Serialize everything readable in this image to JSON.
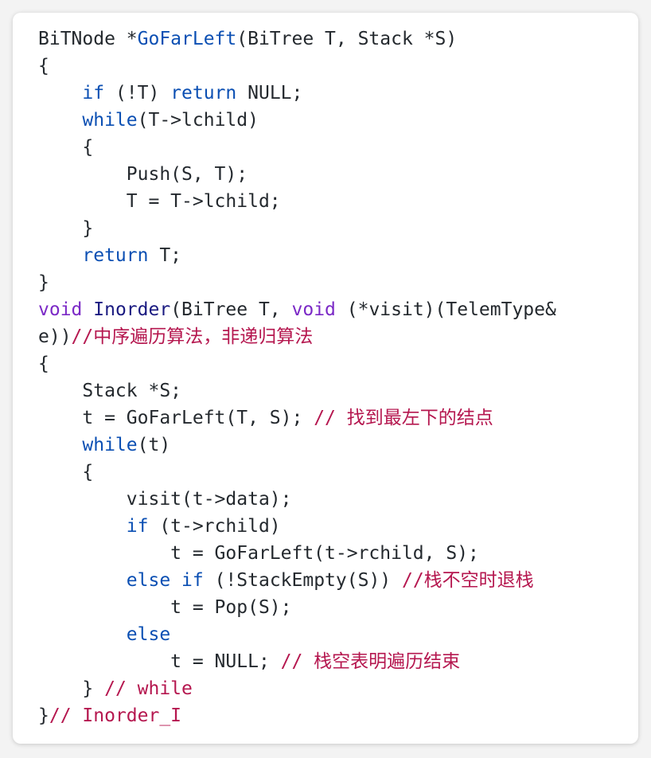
{
  "colors": {
    "background": "#f3f3f3",
    "card": "#ffffff",
    "plain": "#24292e",
    "keyword": "#0b4fb3",
    "type_keyword": "#7b29c6",
    "comment": "#b5174f"
  },
  "code": {
    "lines": [
      [
        {
          "t": "BiTNode *",
          "c": "plain"
        },
        {
          "t": "GoFarLeft",
          "c": "fn"
        },
        {
          "t": "(BiTree T, Stack *S)",
          "c": "plain"
        }
      ],
      [
        {
          "t": "{",
          "c": "plain"
        }
      ],
      [
        {
          "t": "    ",
          "c": "plain"
        },
        {
          "t": "if",
          "c": "kw"
        },
        {
          "t": " (!T) ",
          "c": "plain"
        },
        {
          "t": "return",
          "c": "kw"
        },
        {
          "t": " NULL;",
          "c": "plain"
        }
      ],
      [
        {
          "t": "    ",
          "c": "plain"
        },
        {
          "t": "while",
          "c": "kw"
        },
        {
          "t": "(T->lchild)",
          "c": "plain"
        }
      ],
      [
        {
          "t": "    {",
          "c": "plain"
        }
      ],
      [
        {
          "t": "        Push(S, T);",
          "c": "plain"
        }
      ],
      [
        {
          "t": "        T = T->lchild;",
          "c": "plain"
        }
      ],
      [
        {
          "t": "    }",
          "c": "plain"
        }
      ],
      [
        {
          "t": "    ",
          "c": "plain"
        },
        {
          "t": "return",
          "c": "kw"
        },
        {
          "t": " T;",
          "c": "plain"
        }
      ],
      [
        {
          "t": "}",
          "c": "plain"
        }
      ],
      [
        {
          "t": "void",
          "c": "type"
        },
        {
          "t": " ",
          "c": "plain"
        },
        {
          "t": "Inorder",
          "c": "fnd"
        },
        {
          "t": "(BiTree T, ",
          "c": "plain"
        },
        {
          "t": "void",
          "c": "type"
        },
        {
          "t": " (*visit)(TelemType&",
          "c": "plain"
        }
      ],
      [
        {
          "t": "e))",
          "c": "plain"
        },
        {
          "t": "//中序遍历算法，非递归算法",
          "c": "comment"
        }
      ],
      [
        {
          "t": "{",
          "c": "plain"
        }
      ],
      [
        {
          "t": "    Stack *S;",
          "c": "plain"
        }
      ],
      [
        {
          "t": "    t = GoFarLeft(T, S); ",
          "c": "plain"
        },
        {
          "t": "// 找到最左下的结点",
          "c": "comment"
        }
      ],
      [
        {
          "t": "    ",
          "c": "plain"
        },
        {
          "t": "while",
          "c": "kw"
        },
        {
          "t": "(t)",
          "c": "plain"
        }
      ],
      [
        {
          "t": "    {",
          "c": "plain"
        }
      ],
      [
        {
          "t": "        visit(t->data);",
          "c": "plain"
        }
      ],
      [
        {
          "t": "        ",
          "c": "plain"
        },
        {
          "t": "if",
          "c": "kw"
        },
        {
          "t": " (t->rchild)",
          "c": "plain"
        }
      ],
      [
        {
          "t": "            t = GoFarLeft(t->rchild, S);",
          "c": "plain"
        }
      ],
      [
        {
          "t": "        ",
          "c": "plain"
        },
        {
          "t": "else",
          "c": "kw"
        },
        {
          "t": " ",
          "c": "plain"
        },
        {
          "t": "if",
          "c": "kw"
        },
        {
          "t": " (!StackEmpty(S)) ",
          "c": "plain"
        },
        {
          "t": "//栈不空时退栈",
          "c": "comment"
        }
      ],
      [
        {
          "t": "            t = Pop(S);",
          "c": "plain"
        }
      ],
      [
        {
          "t": "        ",
          "c": "plain"
        },
        {
          "t": "else",
          "c": "kw"
        }
      ],
      [
        {
          "t": "            t = NULL; ",
          "c": "plain"
        },
        {
          "t": "// 栈空表明遍历结束",
          "c": "comment"
        }
      ],
      [
        {
          "t": "    } ",
          "c": "plain"
        },
        {
          "t": "// while",
          "c": "comment"
        }
      ],
      [
        {
          "t": "}",
          "c": "plain"
        },
        {
          "t": "// Inorder_I",
          "c": "comment"
        }
      ]
    ]
  }
}
